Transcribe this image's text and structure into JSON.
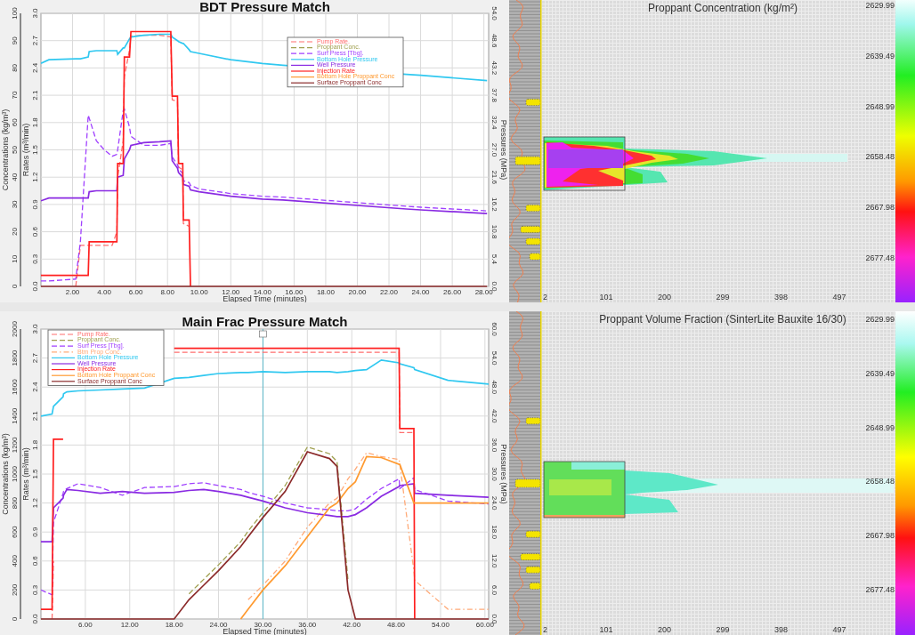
{
  "pressure_charts": [
    {
      "concentration_axis": {
        "label": "Concentrations (kg/m³)",
        "ticks": [
          "0",
          "10",
          "20",
          "30",
          "40",
          "50",
          "60",
          "70",
          "80",
          "90",
          "100"
        ]
      },
      "pressure_axis": {
        "label": "Pressures (MPa)",
        "ticks": [
          "0.0",
          "5.4",
          "10.8",
          "16.2",
          "21.6",
          "27.0",
          "32.4",
          "37.8",
          "43.2",
          "48.6",
          "54.0"
        ]
      },
      "chart_data": {
        "type": "line",
        "title": "BDT Pressure Match",
        "xlabel": "Elapsed Time (minutes)",
        "ylabel": "Rates (m³/min)",
        "xlim": [
          0,
          28.3
        ],
        "ylim": [
          0,
          3
        ],
        "grid": true,
        "legend": "upper right",
        "xticks": [
          {
            "value": 2,
            "label": "2.00"
          },
          {
            "value": 4,
            "label": "4.00"
          },
          {
            "value": 6,
            "label": "6.00"
          },
          {
            "value": 8,
            "label": "8.00"
          },
          {
            "value": 10,
            "label": "10.00"
          },
          {
            "value": 12,
            "label": "12.00"
          },
          {
            "value": 14,
            "label": "14.00"
          },
          {
            "value": 16,
            "label": "16.00"
          },
          {
            "value": 18,
            "label": "18.00"
          },
          {
            "value": 20,
            "label": "20.00"
          },
          {
            "value": 22,
            "label": "22.00"
          },
          {
            "value": 24,
            "label": "24.00"
          },
          {
            "value": 26,
            "label": "26.00"
          },
          {
            "value": 28,
            "label": "28.00"
          }
        ],
        "yticks": [
          {
            "value": 0,
            "label": "0.0"
          },
          {
            "value": 0.3,
            "label": "0.3"
          },
          {
            "value": 0.6,
            "label": "0.6"
          },
          {
            "value": 0.9,
            "label": "0.9"
          },
          {
            "value": 1.2,
            "label": "1.2"
          },
          {
            "value": 1.5,
            "label": "1.5"
          },
          {
            "value": 1.8,
            "label": "1.8"
          },
          {
            "value": 2.1,
            "label": "2.1"
          },
          {
            "value": 2.4,
            "label": "2.4"
          },
          {
            "value": 2.7,
            "label": "2.7"
          },
          {
            "value": 3,
            "label": "3.0"
          }
        ],
        "x": [
          0,
          0.5,
          2.2,
          2.5,
          2.99,
          3.05,
          3.5,
          4.0,
          4.5,
          4.8,
          4.85,
          5.2,
          5.27,
          5.6,
          5.69,
          6.5,
          7.5,
          8.21,
          8.3,
          8.63,
          8.7,
          8.96,
          9.0,
          9.37,
          9.45,
          10,
          12,
          14,
          15.3,
          23.1,
          24,
          28.2
        ],
        "series": [
          {
            "name": "Pump Rate.",
            "color": "#ff6f6f",
            "line_style": "dashed",
            "values": [
              null,
              null,
              0,
              0.45,
              0.45,
              0.45,
              0.45,
              0.45,
              0.45,
              0.6,
              1.2,
              1.6,
              2.3,
              2.6,
              2.75,
              2.76,
              2.76,
              2.74,
              2.05,
              2.03,
              1.31,
              1.28,
              0.69,
              0.66,
              null,
              null,
              null,
              null,
              null,
              null,
              null,
              null
            ]
          },
          {
            "name": "Proppant Conc.",
            "color": "#a0a050",
            "line_style": "dashed",
            "values": [
              null,
              null,
              null,
              null,
              null,
              null,
              null,
              null,
              null,
              null,
              null,
              null,
              null,
              null,
              null,
              null,
              null,
              null,
              null,
              null,
              null,
              null,
              null,
              null,
              null,
              null,
              null,
              null,
              null,
              null,
              null,
              null
            ]
          },
          {
            "name": "Surf Press [Tbg].",
            "color": "#a040ff",
            "line_style": "dashed",
            "values": [
              0.06,
              0.06,
              0.08,
              0.5,
              1.88,
              1.85,
              1.6,
              1.5,
              1.43,
              1.45,
              1.5,
              1.93,
              1.95,
              1.75,
              1.65,
              1.55,
              1.55,
              1.57,
              1.42,
              1.34,
              1.29,
              1.24,
              1.16,
              1.14,
              1.11,
              1.07,
              1.02,
              0.99,
              0.98,
              0.88,
              0.87,
              0.83
            ]
          },
          {
            "name": "Bottom Hole Pressure",
            "color": "#30c8f0",
            "line_style": "solid",
            "values": [
              2.45,
              2.49,
              2.5,
              2.5,
              2.52,
              2.58,
              2.59,
              2.59,
              2.59,
              2.59,
              2.55,
              2.62,
              2.62,
              2.72,
              2.74,
              2.76,
              2.77,
              2.77,
              2.74,
              2.7,
              2.69,
              2.67,
              2.67,
              2.6,
              2.58,
              2.56,
              2.49,
              2.45,
              2.43,
              2.33,
              2.32,
              2.26
            ]
          },
          {
            "name": "Well Pressure",
            "color": "#8a2be2",
            "line_style": "solid",
            "values": [
              0.94,
              0.97,
              0.97,
              0.97,
              0.97,
              1.04,
              1.05,
              1.05,
              1.05,
              1.05,
              1.2,
              1.22,
              1.4,
              1.5,
              1.55,
              1.58,
              1.59,
              1.6,
              1.38,
              1.3,
              1.25,
              1.2,
              1.12,
              1.1,
              1.06,
              1.04,
              0.99,
              0.96,
              0.95,
              0.85,
              0.84,
              0.8
            ]
          },
          {
            "name": "Injection Rate",
            "color": "#ff2020",
            "line_style": "solid",
            "values": [
              0.12,
              0.12,
              0.12,
              0.12,
              0.12,
              0.49,
              0.49,
              0.49,
              0.49,
              0.49,
              1.35,
              1.35,
              2.52,
              2.52,
              2.8,
              2.8,
              2.8,
              2.8,
              2.09,
              2.09,
              1.35,
              1.35,
              0.73,
              0.73,
              0,
              null,
              null,
              null,
              null,
              null,
              null,
              null
            ]
          },
          {
            "name": "Bottom Hole Proppant Conc",
            "color": "#ff9a30",
            "line_style": "solid",
            "values": [
              null,
              null,
              null,
              null,
              null,
              null,
              null,
              null,
              null,
              null,
              null,
              null,
              null,
              null,
              null,
              null,
              null,
              null,
              null,
              null,
              null,
              null,
              null,
              null,
              null,
              null,
              null,
              null,
              null,
              null,
              null,
              null
            ]
          },
          {
            "name": "Surface Proppant Conc",
            "color": "#8b2a2a",
            "line_style": "solid",
            "values": [
              0,
              0,
              0,
              0,
              0,
              0,
              0,
              0,
              0,
              0,
              0,
              0,
              0,
              0,
              0,
              0,
              0,
              0,
              0,
              0,
              0,
              0,
              0,
              0,
              0,
              0,
              0,
              0,
              0,
              0,
              0,
              0
            ]
          }
        ]
      }
    },
    {
      "concentration_axis": {
        "label": "Concentrations (kg/m³)",
        "ticks": [
          "0",
          "200",
          "400",
          "600",
          "800",
          "1000",
          "1200",
          "1400",
          "1600",
          "1800",
          "2000"
        ]
      },
      "pressure_axis": {
        "label": "Pressures (MPa)",
        "ticks": [
          "0.0",
          "6.0",
          "12.0",
          "18.0",
          "24.0",
          "30.0",
          "36.0",
          "42.0",
          "48.0",
          "54.0",
          "60.0"
        ]
      },
      "chart_data": {
        "type": "line",
        "title": "Main Frac Pressure Match",
        "xlabel": "Elapsed Time (minutes)",
        "ylabel": "Rates (m³/min)",
        "xlim": [
          0,
          60.5
        ],
        "ylim": [
          0,
          3
        ],
        "grid": true,
        "legend": "upper left",
        "xticks": [
          {
            "value": 6,
            "label": "6.00"
          },
          {
            "value": 12,
            "label": "12.00"
          },
          {
            "value": 18,
            "label": "18.00"
          },
          {
            "value": 24,
            "label": "24.00"
          },
          {
            "value": 30,
            "label": "30.00"
          },
          {
            "value": 36,
            "label": "36.00"
          },
          {
            "value": 42,
            "label": "42.00"
          },
          {
            "value": 48,
            "label": "48.00"
          },
          {
            "value": 54,
            "label": "54.00"
          },
          {
            "value": 60,
            "label": "60.00"
          }
        ],
        "yticks": [
          {
            "value": 0,
            "label": "0.0"
          },
          {
            "value": 0.3,
            "label": "0.3"
          },
          {
            "value": 0.6,
            "label": "0.6"
          },
          {
            "value": 0.9,
            "label": "0.9"
          },
          {
            "value": 1.2,
            "label": "1.2"
          },
          {
            "value": 1.5,
            "label": "1.5"
          },
          {
            "value": 1.8,
            "label": "1.8"
          },
          {
            "value": 2.1,
            "label": "2.1"
          },
          {
            "value": 2.4,
            "label": "2.4"
          },
          {
            "value": 2.7,
            "label": "2.7"
          },
          {
            "value": 3,
            "label": "3.0"
          }
        ],
        "x": [
          0,
          1.5,
          1.7,
          3.0,
          3.05,
          3.5,
          5,
          8,
          11,
          14,
          18,
          20,
          22,
          24,
          27,
          28,
          30,
          33,
          36,
          39,
          40,
          41.5,
          42.5,
          44,
          46,
          48.4,
          48.5,
          50.4,
          50.5,
          55,
          60.5
        ],
        "series": [
          {
            "name": "Pump Rate.",
            "color": "#ff6f6f",
            "line_style": "dashed",
            "values": [
              null,
              0,
              0.6,
              null,
              null,
              null,
              null,
              null,
              null,
              null,
              2.76,
              2.76,
              2.76,
              2.76,
              2.76,
              2.76,
              2.76,
              2.76,
              2.76,
              2.76,
              2.76,
              2.76,
              2.76,
              2.76,
              2.76,
              2.76,
              1.93,
              1.93,
              null,
              null,
              null
            ]
          },
          {
            "name": "Proppant Conc.",
            "color": "#a0a050",
            "line_style": "dashed",
            "values": [
              null,
              null,
              null,
              null,
              null,
              null,
              null,
              null,
              null,
              null,
              null,
              0.26,
              0.41,
              0.56,
              0.8,
              0.91,
              1.1,
              1.38,
              1.78,
              1.71,
              1.63,
              0.4,
              null,
              null,
              null,
              null,
              null,
              null,
              null,
              null,
              null
            ]
          },
          {
            "name": "Surf Press [Tbg].",
            "color": "#a040ff",
            "line_style": "dashed",
            "values": [
              0.3,
              0.25,
              1.0,
              1.3,
              1.32,
              1.35,
              1.4,
              1.36,
              1.28,
              1.36,
              1.37,
              1.4,
              1.41,
              1.38,
              1.34,
              1.31,
              1.27,
              1.2,
              1.15,
              1.13,
              1.12,
              1.12,
              1.14,
              1.24,
              1.35,
              1.45,
              1.35,
              1.46,
              1.34,
              1.22,
              1.19
            ]
          },
          {
            "name": "Btm Prop Conc.",
            "color": "#ffaa78",
            "line_style": "dashdot",
            "values": [
              null,
              null,
              null,
              null,
              null,
              null,
              null,
              null,
              null,
              null,
              null,
              null,
              null,
              null,
              null,
              0.2,
              0.35,
              0.6,
              0.95,
              1.2,
              1.25,
              1.45,
              1.55,
              1.72,
              1.68,
              1.65,
              1.6,
              0.5,
              0.4,
              0.1,
              0.1
            ]
          },
          {
            "name": "Bottom Hole Pressure",
            "color": "#30c8f0",
            "line_style": "solid",
            "values": [
              2.1,
              2.12,
              2.2,
              2.3,
              2.33,
              2.35,
              2.36,
              2.37,
              2.38,
              2.39,
              2.49,
              2.5,
              2.52,
              2.54,
              2.55,
              2.55,
              2.56,
              2.55,
              2.56,
              2.56,
              2.55,
              2.56,
              2.57,
              2.58,
              2.68,
              2.65,
              2.64,
              2.6,
              2.58,
              2.47,
              2.43
            ]
          },
          {
            "name": "Well Pressure",
            "color": "#8a2be2",
            "line_style": "solid",
            "values": [
              0.8,
              0.8,
              1.15,
              1.25,
              1.28,
              1.34,
              1.33,
              1.3,
              1.32,
              1.3,
              1.31,
              1.33,
              1.34,
              1.32,
              1.28,
              1.26,
              1.22,
              1.15,
              1.1,
              1.07,
              1.06,
              1.06,
              1.08,
              1.15,
              1.27,
              1.37,
              1.38,
              1.4,
              1.3,
              1.28,
              1.26
            ]
          },
          {
            "name": "Injection Rate",
            "color": "#ff2020",
            "line_style": "solid",
            "values": [
              0.1,
              0.1,
              1.86,
              1.86,
              null,
              null,
              null,
              null,
              null,
              null,
              2.8,
              2.8,
              2.8,
              2.8,
              2.8,
              2.8,
              2.8,
              2.8,
              2.8,
              2.8,
              2.8,
              2.8,
              2.8,
              2.8,
              2.8,
              2.8,
              1.97,
              1.97,
              0,
              null,
              null
            ]
          },
          {
            "name": "Bottom Hole Proppant Conc",
            "color": "#ff9a30",
            "line_style": "solid",
            "values": [
              null,
              null,
              null,
              null,
              null,
              null,
              null,
              null,
              null,
              null,
              null,
              null,
              null,
              null,
              0,
              0.1,
              0.3,
              0.55,
              0.85,
              1.15,
              1.2,
              1.35,
              1.42,
              1.68,
              1.67,
              1.6,
              1.6,
              1.2,
              1.2,
              1.2,
              1.2
            ]
          },
          {
            "name": "Surface Proppant Conc",
            "color": "#8b2a2a",
            "line_style": "solid",
            "values": [
              0,
              0,
              0,
              0,
              0,
              0,
              0,
              0,
              0,
              0,
              0,
              0.2,
              0.35,
              0.5,
              0.75,
              0.85,
              1.05,
              1.32,
              1.73,
              1.66,
              1.58,
              0.3,
              0,
              0,
              0,
              0,
              0,
              0,
              0,
              0,
              0
            ]
          }
        ],
        "ref_lines": [
          {
            "axis": "x",
            "value": 30
          }
        ]
      }
    }
  ],
  "fracture_plots": [
    {
      "kind": "concentration",
      "title": "Proppant Concentration (kg/m²)",
      "depth_labels": [
        "2629.99",
        "2639.49",
        "2648.99",
        "2658.48",
        "2667.98",
        "2677.48"
      ],
      "length_labels": [
        "2",
        "101",
        "200",
        "299",
        "398",
        "497"
      ]
    },
    {
      "kind": "volume_fraction",
      "title": "Proppant Volume Fraction (SinterLite Bauxite 16/30)",
      "depth_labels": [
        "2629.99",
        "2639.49",
        "2648.99",
        "2658.48",
        "2667.98",
        "2677.48"
      ],
      "length_labels": [
        "2",
        "101",
        "200",
        "299",
        "398",
        "497"
      ]
    }
  ]
}
